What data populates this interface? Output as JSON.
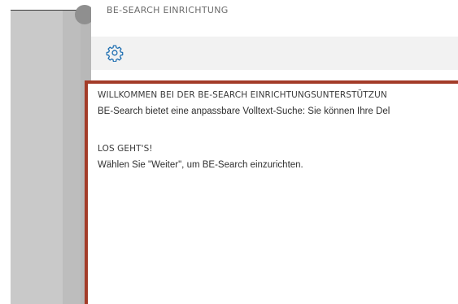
{
  "panel": {
    "title": "BE-SEARCH EINRICHTUNG",
    "toolbar": {
      "settings_icon": "gear-icon"
    }
  },
  "content": {
    "welcome_heading": "WILLKOMMEN BEI DER BE-SEARCH EINRICHTUNGSUNTERSTÜTZUN",
    "welcome_text": "BE-Search bietet eine anpassbare Volltext-Suche: Sie können Ihre Del",
    "start_heading": "LOS GEHT'S!",
    "start_text": "Wählen Sie \"Weiter\", um BE-Search einzurichten."
  },
  "colors": {
    "accent_border": "#a33b28",
    "toolbar_bg": "#f2f2f2",
    "backdrop": "#c9c9c9"
  }
}
